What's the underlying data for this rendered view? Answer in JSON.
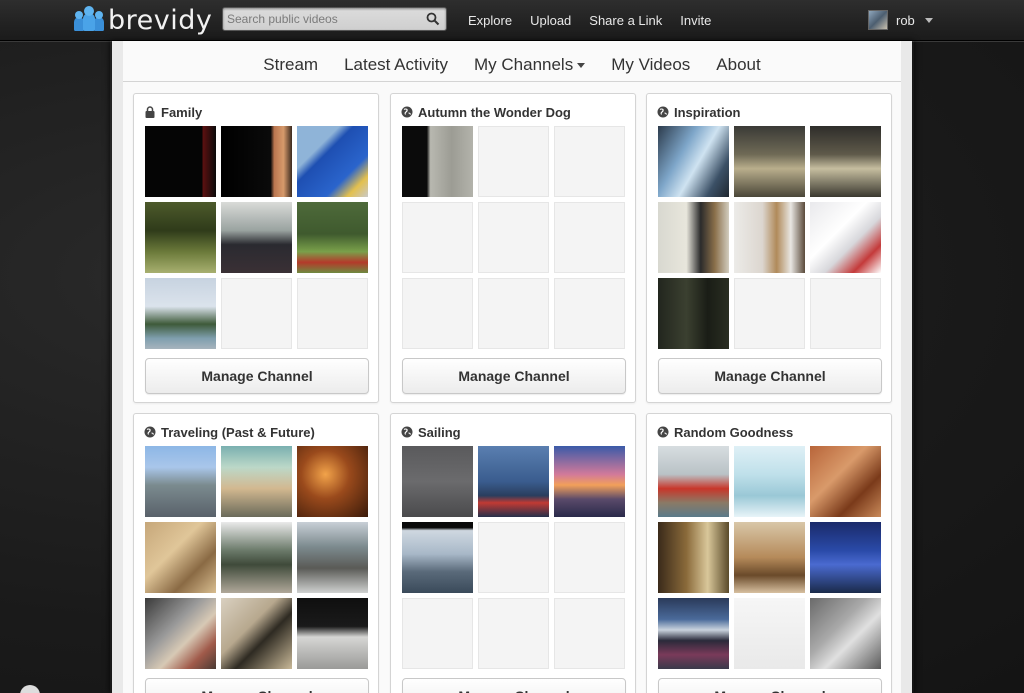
{
  "brand": {
    "name": "brevidy"
  },
  "search": {
    "placeholder": "Search public videos",
    "icon": "search-icon"
  },
  "topnav": [
    "Explore",
    "Upload",
    "Share a Link",
    "Invite"
  ],
  "user": {
    "name": "rob"
  },
  "subnav": [
    "Stream",
    "Latest Activity",
    "My Channels",
    "My Videos",
    "About"
  ],
  "manage_label": "Manage Channel",
  "channels": [
    {
      "title": "Family",
      "privacy": "lock-icon",
      "thumbs": [
        "linear-gradient(90deg,#050505 0%,#050505 80%,#5a1010 82%,#0a0a0a 100%)",
        "linear-gradient(90deg,#000 0%,#0a0a0a 70%,#b9754f 75%,#d79a6b 88%,#3b2a1f 100%)",
        "linear-gradient(135deg,#8fb4d8 0%,#8fb4d8 30%,#1e4fb2 40%,#2a64cc 70%,#e3c04e 85%,#c9c9c9 100%)",
        "linear-gradient(180deg,#4d5a2b 0%,#2f3b1a 40%,#6b7a3a 70%,#a8b070 100%)",
        "linear-gradient(180deg,#d9dbd8 0%,#9aa3a0 40%,#2a2a30 60%,#3a3035 100%)",
        "linear-gradient(180deg,#4e6a3a 0%,#3f5a2e 45%,#7aa04a 70%,#b43a2a 85%,#6e8a40 100%)",
        "linear-gradient(180deg,#c7d3e0 0%,#dbe3ec 40%,#3e5a3a 65%,#7f9fae 85%,#a7b4bd 100%)",
        "",
        ""
      ]
    },
    {
      "title": "Autumn the Wonder Dog",
      "privacy": "globe-icon",
      "thumbs": [
        "linear-gradient(90deg,#0b0b0b 0%,#0b0b0b 35%,#b8b8b0 40%,#9c9c94 70%,#b3b3ab 100%)",
        "",
        "",
        "",
        "",
        "",
        "",
        "",
        ""
      ]
    },
    {
      "title": "Inspiration",
      "privacy": "globe-icon",
      "thumbs": [
        "linear-gradient(120deg,#2c3b4c 0%,#7ea6c9 35%,#cfe3f1 55%,#3b5066 80%,#1f2730 100%)",
        "linear-gradient(180deg,#3a3a36 0%,#6f6a56 40%,#b9ae8c 60%,#4a4638 100%)",
        "linear-gradient(180deg,#2e2d2a 0%,#5f5a4a 40%,#c6bea0 60%,#3a382f 100%)",
        "linear-gradient(90deg,#d8d8d0 0%,#e8e6dc 40%,#2b2b2b 60%,#8a6f4a 80%,#d2cdbf 100%)",
        "linear-gradient(90deg,#ecebe8 0%,#dcd6cf 40%,#b08a5a 60%,#e8e6e2 80%,#5a4a3a 100%)",
        "linear-gradient(135deg,#e9e9ec 0%,#ffffff 40%,#d7d7db 60%,#c43a3a 80%,#ffffff 100%)",
        "linear-gradient(90deg,#22261e 0%,#3b4030 40%,#1a1d16 70%,#2a2e22 100%)",
        "",
        ""
      ]
    },
    {
      "title": "Traveling (Past & Future)",
      "privacy": "globe-icon",
      "thumbs": [
        "linear-gradient(180deg,#8db7e6 0%,#a9c6ea 30%,#7b8b8f 55%,#59616a 100%)",
        "linear-gradient(180deg,#7ab0b0 0%,#bcd8c8 30%,#d2b890 60%,#6a6a5a 100%)",
        "radial-gradient(circle at 40% 40%,#f2a34a 0%,#9a4a1c 40%,#3a1a0a 100%)",
        "linear-gradient(135deg,#c6a77a 0%,#e0c699 40%,#8a6a44 70%,#d8bd90 100%)",
        "linear-gradient(180deg,#eaeaea 0%,#6b7a6a 40%,#3f4a3a 60%,#b0a89a 100%)",
        "linear-gradient(180deg,#c8cfd6 0%,#7c8a8e 35%,#5a5a56 65%,#cfd1d0 100%)",
        "linear-gradient(135deg,#3a3a3a 0%,#9a9a9a 40%,#d7c9b5 60%,#a05a4a 80%,#4a3a33 100%)",
        "linear-gradient(135deg,#d9d0c0 0%,#b7a88e 40%,#2e2a22 60%,#c8b898 100%)",
        "linear-gradient(180deg,#0f0f0f 0%,#1a1a1a 40%,#d6d6d4 55%,#9a9a98 100%)"
      ]
    },
    {
      "title": "Sailing",
      "privacy": "globe-icon",
      "thumbs": [
        "linear-gradient(180deg,#5a5a5c 0%,#6b6b6d 50%,#4a4a4c 100%)",
        "linear-gradient(180deg,#5a7fb0 0%,#3a5c8e 50%,#2a3e5e 70%,#c13a33 80%,#25304a 100%)",
        "linear-gradient(180deg,#3a5aa8 0%,#d27a9a 40%,#f2a05a 55%,#5a4a6a 75%,#2a2a4a 100%)",
        "linear-gradient(180deg,#0a0a0a 0%,#0a0a0a 8%,#cfd8e0 12%,#a8b8c8 45%,#5a6a7a 70%,#3a4a5a 100%)",
        "",
        "",
        "",
        "",
        ""
      ]
    },
    {
      "title": "Random Goodness",
      "privacy": "globe-icon",
      "thumbs": [
        "linear-gradient(180deg,#d7dde0 0%,#b9c2c6 40%,#c8362a 60%,#8a7a66 80%,#5a7a8a 100%)",
        "linear-gradient(180deg,#dff0f6 0%,#bfe0ea 40%,#9ac8d6 70%,#e8f4f8 100%)",
        "linear-gradient(135deg,#b8653a 0%,#d99a6a 40%,#7a3a1a 70%,#c98a5a 100%)",
        "linear-gradient(90deg,#3a2a1a 0%,#8a6a3a 40%,#d9c79a 70%,#5a4a2a 100%)",
        "linear-gradient(180deg,#d9c7a8 0%,#b58a5a 50%,#6a4a2a 75%,#d7c0a0 100%)",
        "linear-gradient(180deg,#1a2a6a 0%,#2a4aa8 40%,#4a6ad0 60%,#1a2a4a 100%)",
        "linear-gradient(180deg,#2a3a5a 0%,#4a6a9a 30%,#c9d3dd 45%,#2a2a3a 60%,#7a3a5a 80%,#3a3a4a 100%)",
        "linear-gradient(180deg,#f6f6f6 0%,#e9e9e9 100%)",
        "linear-gradient(135deg,#6a6a6a 0%,#a9a9a9 40%,#e0e0e0 60%,#5a5a5a 100%)"
      ]
    }
  ]
}
